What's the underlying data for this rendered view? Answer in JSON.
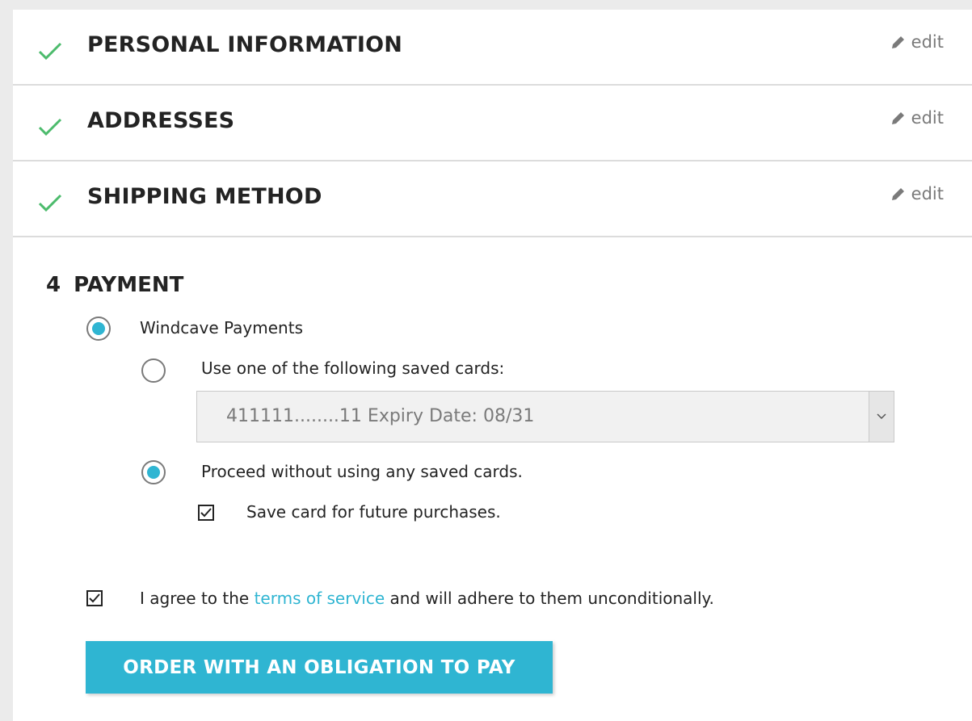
{
  "steps": [
    {
      "title": "PERSONAL INFORMATION",
      "edit_label": "edit",
      "status_icon": "check-icon"
    },
    {
      "title": "ADDRESSES",
      "edit_label": "edit",
      "status_icon": "check-icon"
    },
    {
      "title": "SHIPPING METHOD",
      "edit_label": "edit",
      "status_icon": "check-icon"
    }
  ],
  "payment": {
    "step_number": "4",
    "title": "PAYMENT",
    "method_label": "Windcave Payments",
    "method_selected": true,
    "saved_cards_label": "Use one of the following saved cards:",
    "saved_cards_selected": false,
    "saved_card_value": "411111........11 Expiry Date: 08/31",
    "proceed_label": "Proceed without using any saved cards.",
    "proceed_selected": true,
    "save_card_label": "Save card for future purchases.",
    "save_card_checked": true
  },
  "terms": {
    "prefix": "I agree to the",
    "link_text": "terms of service",
    "suffix": "and will adhere to them unconditionally.",
    "checked": true
  },
  "order_button_label": "ORDER WITH AN OBLIGATION TO PAY",
  "colors": {
    "accent": "#2fb5d2",
    "check_green": "#4cbb6c",
    "muted_text": "#7a7a7a"
  }
}
